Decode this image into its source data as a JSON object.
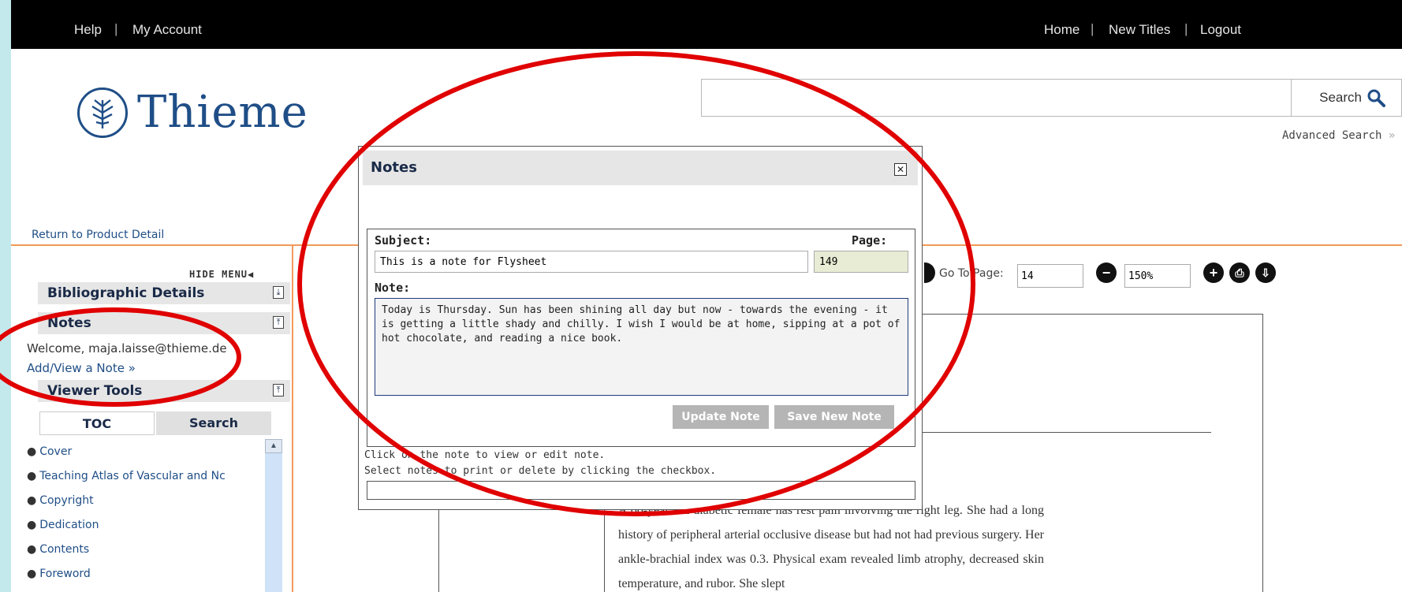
{
  "topnav": {
    "left": [
      "Help",
      "My Account"
    ],
    "right": [
      "Home",
      "New Titles",
      "Logout"
    ]
  },
  "brand": {
    "name": "Thieme",
    "icon": "tree-icon"
  },
  "search": {
    "button_label": "Search",
    "advanced_label": "Advanced Search",
    "query": ""
  },
  "return_link": "Return to Product Detail",
  "sidebar": {
    "hide_menu": "HIDE MENU",
    "sections": [
      "Bibliographic Details",
      "Notes",
      "Viewer Tools"
    ],
    "welcome": "Welcome, maja.laisse@thieme.de",
    "add_view_note": "Add/View a Note »",
    "tabs": [
      "TOC",
      "Search"
    ],
    "toc": [
      "Cover",
      "Teaching Atlas of Vascular and Nc",
      "Copyright",
      "Dedication",
      "Contents",
      "Foreword"
    ]
  },
  "viewer": {
    "go_to_label": "Go To Page:",
    "go_to_value": "14",
    "zoom_value": "150%",
    "body_text": "A 66-year-old diabetic female has rest pain involving the right leg. She had a long history of peripheral arterial occlusive disease but had not had previous surgery. Her ankle-brachial index was 0.3. Physical exam revealed limb atrophy, decreased skin temperature, and rubor. She slept"
  },
  "dialog": {
    "title": "Notes",
    "subject_label": "Subject:",
    "page_label": "Page:",
    "subject_value": "This is a note for Flysheet",
    "page_value": "149",
    "note_label": "Note:",
    "note_value": "Today is  Thursday. Sun has been shining all day but now - towards the evening - it is getting a little shady and chilly. I wish I would be at home, sipping at a pot of hot chocolate, and reading a nice book.",
    "update_button": "Update Note",
    "save_button": "Save New Note",
    "info_1": "Click on the note to view or edit note.",
    "info_2": "Select notes to print or delete by clicking the checkbox."
  },
  "colors": {
    "accent_blue": "#1f4e87",
    "annotation_red": "#e00000",
    "divider_orange": "#f19a5a"
  }
}
